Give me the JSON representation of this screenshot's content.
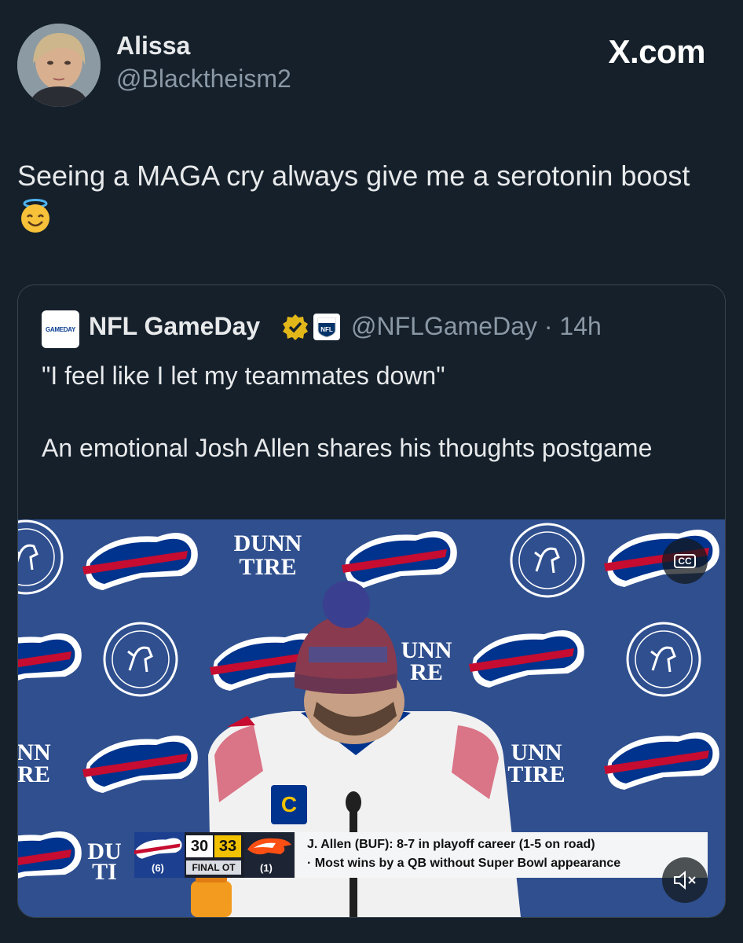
{
  "post": {
    "author_name": "Alissa",
    "author_handle": "@Blacktheism2",
    "site_label": "X.com",
    "text": "Seeing a MAGA cry always give me a serotonin boost",
    "emoji": "smiling-face-with-halo"
  },
  "quoted": {
    "account_name": "NFL GameDay",
    "logo_text": "GAMEDAY",
    "handle_and_time": "@NFLGameDay · 14h",
    "line1": "\"I feel like I let my teammates down\"",
    "line2": "An emotional Josh Allen shares his thoughts postgame"
  },
  "video": {
    "backdrop_text_1": "DUNN",
    "backdrop_text_2": "TIRE",
    "cc_label": "CC",
    "chyron": {
      "score_buf": "30",
      "score_den": "33",
      "status": "FINAL OT",
      "seed_buf": "(6)",
      "seed_den": "(1)",
      "stat_line1": "J. Allen (BUF): 8-7 in playoff career (1-5 on road)",
      "stat_line2": "· Most wins by a QB without Super Bowl appearance"
    },
    "jersey_patch": "C"
  },
  "colors": {
    "background": "#15202b",
    "text": "#e7e9ea",
    "muted": "#8b98a5",
    "border": "#38444d",
    "bills_blue": "#00338d",
    "bills_red": "#c60c30",
    "verified_gold": "#e2b719"
  }
}
